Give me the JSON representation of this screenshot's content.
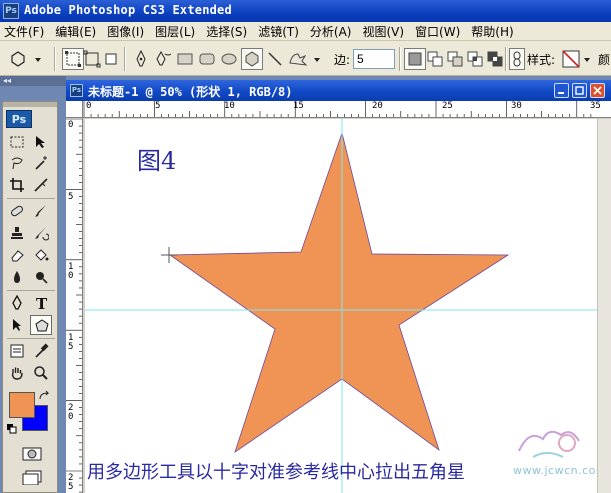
{
  "app": {
    "title": "Adobe Photoshop CS3 Extended",
    "logo": "Ps"
  },
  "menu": [
    "文件(F)",
    "编辑(E)",
    "图像(I)",
    "图层(L)",
    "选择(S)",
    "滤镜(T)",
    "分析(A)",
    "视图(V)",
    "窗口(W)",
    "帮助(H)"
  ],
  "options": {
    "sides_label": "边:",
    "sides_value": "5",
    "style_label": "样式:",
    "color_label": "颜"
  },
  "dock": {
    "collapse_glyph": "◂◂"
  },
  "toolbox": {
    "badge": "Ps",
    "foreground_color": "#f09455",
    "background_color": "#0000ff"
  },
  "document": {
    "title": "未标题-1 @ 50% (形状 1, RGB/8)",
    "ruler_h": [
      "0",
      "5",
      "10",
      "15",
      "20",
      "25",
      "30",
      "35"
    ],
    "ruler_v": [
      "0",
      "5",
      "1\n0",
      "1\n5",
      "2\n0",
      "2\n5"
    ]
  },
  "canvas": {
    "figure_label": "图4",
    "caption": "用多边形工具以十字对准参考线中心拉出五角星",
    "shape_color": "#f09455",
    "guide_color": "#7fe3ee",
    "watermark": "www.jcwcn.com"
  }
}
